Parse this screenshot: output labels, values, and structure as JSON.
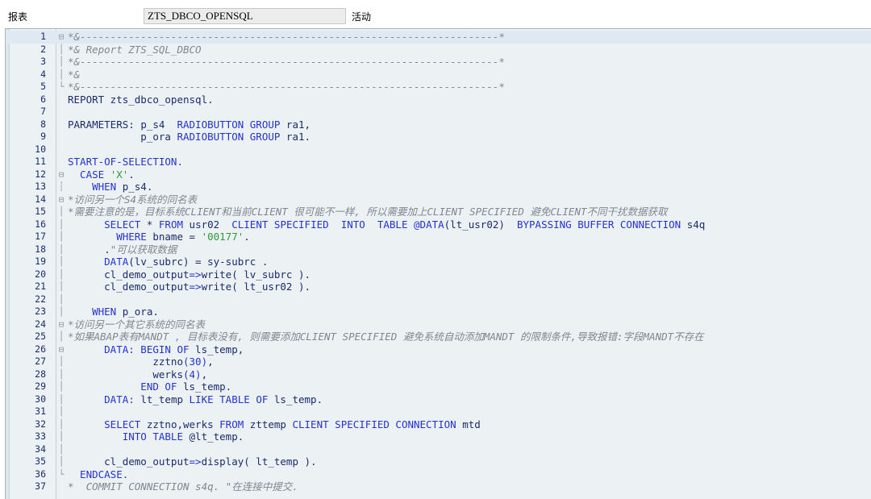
{
  "header": {
    "label": "报表",
    "program_name": "ZTS_DBCO_OPENSQL",
    "status": "活动"
  },
  "editor": {
    "current_line": 1,
    "lines": [
      {
        "n": "1",
        "fold": "⊟",
        "tokens": [
          {
            "t": "*&---------------------------------------------------------------------*",
            "c": "cmt"
          }
        ]
      },
      {
        "n": "2",
        "fold": "│",
        "tokens": [
          {
            "t": "*& Report ZTS_SQL_DBCO",
            "c": "cmt"
          }
        ]
      },
      {
        "n": "3",
        "fold": "│",
        "tokens": [
          {
            "t": "*&---------------------------------------------------------------------*",
            "c": "cmt"
          }
        ]
      },
      {
        "n": "4",
        "fold": "│",
        "tokens": [
          {
            "t": "*&",
            "c": "cmt"
          }
        ]
      },
      {
        "n": "5",
        "fold": "└",
        "tokens": [
          {
            "t": "*&---------------------------------------------------------------------*",
            "c": "cmt"
          }
        ]
      },
      {
        "n": "6",
        "fold": "",
        "tokens": [
          {
            "t": "REPORT zts_dbco_opensql.",
            "c": "id"
          }
        ]
      },
      {
        "n": "7",
        "fold": "",
        "tokens": []
      },
      {
        "n": "8",
        "fold": "",
        "tokens": [
          {
            "t": "PARAMETERS: ",
            "c": "id"
          },
          {
            "t": "p_s4  ",
            "c": "id"
          },
          {
            "t": "RADIOBUTTON GROUP",
            "c": "kw"
          },
          {
            "t": " ra1,",
            "c": "id"
          }
        ]
      },
      {
        "n": "9",
        "fold": "",
        "tokens": [
          {
            "t": "            p_ora ",
            "c": "id"
          },
          {
            "t": "RADIOBUTTON GROUP",
            "c": "kw"
          },
          {
            "t": " ra1.",
            "c": "id"
          }
        ]
      },
      {
        "n": "10",
        "fold": "",
        "tokens": []
      },
      {
        "n": "11",
        "fold": "",
        "tokens": [
          {
            "t": "START-OF-SELECTION.",
            "c": "kw"
          }
        ]
      },
      {
        "n": "12",
        "fold": "⊟",
        "tokens": [
          {
            "t": "  CASE ",
            "c": "kw"
          },
          {
            "t": "'X'",
            "c": "str"
          },
          {
            "t": ".",
            "c": "id"
          }
        ]
      },
      {
        "n": "13",
        "fold": "┆",
        "tokens": [
          {
            "t": "    WHEN ",
            "c": "kw"
          },
          {
            "t": "p_s4.",
            "c": "id"
          }
        ]
      },
      {
        "n": "14",
        "fold": "⊟",
        "tokens": [
          {
            "t": "*访问另一个S4系统的同名表",
            "c": "cmt"
          }
        ]
      },
      {
        "n": "15",
        "fold": "│",
        "tokens": [
          {
            "t": "*需要注意的是，目标系统CLIENT和当前CLIENT 很可能不一样, 所以需要加上CLIENT SPECIFIED 避免CLIENT不同干扰数据获取",
            "c": "cmt"
          }
        ]
      },
      {
        "n": "16",
        "fold": "│",
        "tokens": [
          {
            "t": "      SELECT ",
            "c": "kw"
          },
          {
            "t": "* ",
            "c": "id"
          },
          {
            "t": "FROM ",
            "c": "kw"
          },
          {
            "t": "usr02  ",
            "c": "id"
          },
          {
            "t": "CLIENT SPECIFIED  INTO  TABLE ",
            "c": "kw"
          },
          {
            "t": "@DATA",
            "c": "kw"
          },
          {
            "t": "(lt_usr02)  ",
            "c": "id"
          },
          {
            "t": "BYPASSING BUFFER CONNECTION ",
            "c": "kw"
          },
          {
            "t": "s4q",
            "c": "id"
          }
        ]
      },
      {
        "n": "17",
        "fold": "│",
        "tokens": [
          {
            "t": "        WHERE ",
            "c": "kw"
          },
          {
            "t": "bname = ",
            "c": "id"
          },
          {
            "t": "'00177'",
            "c": "str"
          },
          {
            "t": ".",
            "c": "id"
          }
        ]
      },
      {
        "n": "18",
        "fold": "│",
        "tokens": [
          {
            "t": "      .",
            "c": "id"
          },
          {
            "t": "\"可以获取数据",
            "c": "cmt"
          }
        ]
      },
      {
        "n": "19",
        "fold": "│",
        "tokens": [
          {
            "t": "      DATA",
            "c": "kw"
          },
          {
            "t": "(lv_subrc) = sy-subrc .",
            "c": "id"
          }
        ]
      },
      {
        "n": "20",
        "fold": "│",
        "tokens": [
          {
            "t": "      cl_demo_output",
            "c": "id"
          },
          {
            "t": "=>",
            "c": "kw"
          },
          {
            "t": "write( lv_subrc ).",
            "c": "id"
          }
        ]
      },
      {
        "n": "21",
        "fold": "│",
        "tokens": [
          {
            "t": "      cl_demo_output",
            "c": "id"
          },
          {
            "t": "=>",
            "c": "kw"
          },
          {
            "t": "write( lt_usr02 ).",
            "c": "id"
          }
        ]
      },
      {
        "n": "22",
        "fold": "│",
        "tokens": []
      },
      {
        "n": "23",
        "fold": "│",
        "tokens": [
          {
            "t": "    WHEN ",
            "c": "kw"
          },
          {
            "t": "p_ora.",
            "c": "id"
          }
        ]
      },
      {
        "n": "24",
        "fold": "⊟",
        "tokens": [
          {
            "t": "*访问另一个其它系统的同名表",
            "c": "cmt"
          }
        ]
      },
      {
        "n": "25",
        "fold": "│",
        "tokens": [
          {
            "t": "*如果ABAP表有MANDT , 目标表没有, 则需要添加CLIENT SPECIFIED 避免系统自动添加MANDT 的限制条件,导致报错:字段MANDT不存在",
            "c": "cmt"
          }
        ]
      },
      {
        "n": "26",
        "fold": "⊟",
        "tokens": [
          {
            "t": "      DATA: BEGIN OF ",
            "c": "kw"
          },
          {
            "t": "ls_temp,",
            "c": "id"
          }
        ]
      },
      {
        "n": "27",
        "fold": "│",
        "tokens": [
          {
            "t": "              zztno",
            "c": "id"
          },
          {
            "t": "(30)",
            "c": "num"
          },
          {
            "t": ",",
            "c": "id"
          }
        ]
      },
      {
        "n": "28",
        "fold": "│",
        "tokens": [
          {
            "t": "              werks",
            "c": "id"
          },
          {
            "t": "(4)",
            "c": "num"
          },
          {
            "t": ",",
            "c": "id"
          }
        ]
      },
      {
        "n": "29",
        "fold": "│",
        "tokens": [
          {
            "t": "            END OF ",
            "c": "kw"
          },
          {
            "t": "ls_temp.",
            "c": "id"
          }
        ]
      },
      {
        "n": "30",
        "fold": "│",
        "tokens": [
          {
            "t": "      DATA: ",
            "c": "kw"
          },
          {
            "t": "lt_temp ",
            "c": "id"
          },
          {
            "t": "LIKE TABLE OF ",
            "c": "kw"
          },
          {
            "t": "ls_temp.",
            "c": "id"
          }
        ]
      },
      {
        "n": "31",
        "fold": "│",
        "tokens": []
      },
      {
        "n": "32",
        "fold": "│",
        "tokens": [
          {
            "t": "      SELECT ",
            "c": "kw"
          },
          {
            "t": "zztno,werks ",
            "c": "id"
          },
          {
            "t": "FROM ",
            "c": "kw"
          },
          {
            "t": "zttemp ",
            "c": "id"
          },
          {
            "t": "CLIENT SPECIFIED CONNECTION ",
            "c": "kw"
          },
          {
            "t": "mtd",
            "c": "id"
          }
        ]
      },
      {
        "n": "33",
        "fold": "│",
        "tokens": [
          {
            "t": "         INTO TABLE ",
            "c": "kw"
          },
          {
            "t": "@lt_temp.",
            "c": "id"
          }
        ]
      },
      {
        "n": "34",
        "fold": "│",
        "tokens": []
      },
      {
        "n": "35",
        "fold": "│",
        "tokens": [
          {
            "t": "      cl_demo_output",
            "c": "id"
          },
          {
            "t": "=>",
            "c": "kw"
          },
          {
            "t": "display( lt_temp ).",
            "c": "id"
          }
        ]
      },
      {
        "n": "36",
        "fold": "└",
        "tokens": [
          {
            "t": "  ENDCASE.",
            "c": "kw"
          }
        ]
      },
      {
        "n": "37",
        "fold": "",
        "tokens": [
          {
            "t": "*  COMMIT CONNECTION s4q. \"在连接中提交.",
            "c": "cmt"
          }
        ]
      }
    ]
  },
  "colors": {
    "keyword": "#2432d2",
    "comment": "#7e8890",
    "string": "#2e9a3c",
    "identifier": "#1b2b6e",
    "editor_bg": "#ecf1f3"
  }
}
